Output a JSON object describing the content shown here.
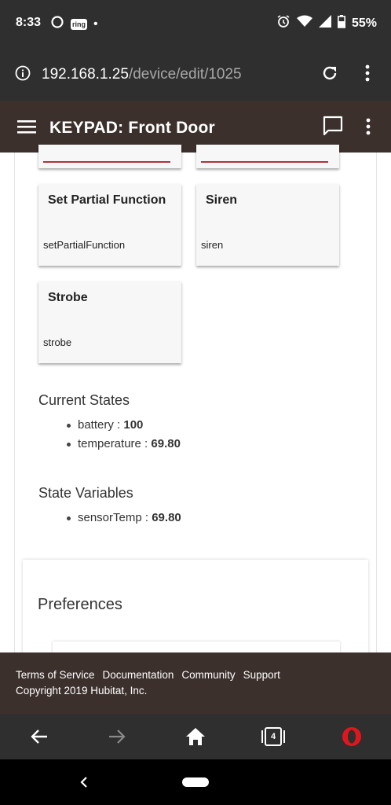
{
  "status_bar": {
    "time": "8:33",
    "ring_label": "ring",
    "dot": "•",
    "battery_percent": "55%",
    "icons": [
      "circle-notification-icon",
      "ring-app-icon",
      "alarm-icon",
      "wifi-icon",
      "signal-icon",
      "battery-icon"
    ]
  },
  "browser": {
    "url_host": "192.168.1.25",
    "url_path": "/device/edit/1025",
    "icons": [
      "info-icon",
      "reload-icon",
      "more-vert-icon"
    ]
  },
  "app_header": {
    "title": "KEYPAD: Front Door",
    "icons": [
      "hamburger-menu-icon",
      "chat-icon",
      "more-vert-icon"
    ]
  },
  "command_cards": [
    {
      "title": "Set Partial Function",
      "command": "setPartialFunction"
    },
    {
      "title": "Siren",
      "command": "siren"
    },
    {
      "title": "Strobe",
      "command": "strobe"
    }
  ],
  "current_states": {
    "heading": "Current States",
    "items": [
      {
        "name": "battery",
        "sep": " : ",
        "value": "100"
      },
      {
        "name": "temperature",
        "sep": " : ",
        "value": "69.80"
      }
    ]
  },
  "state_variables": {
    "heading": "State Variables",
    "items": [
      {
        "name": "sensorTemp",
        "sep": " : ",
        "value": "69.80"
      }
    ]
  },
  "preferences": {
    "heading": "Preferences"
  },
  "footer": {
    "links": [
      "Terms of Service",
      "Documentation",
      "Community",
      "Support"
    ],
    "copyright": "Copyright 2019 Hubitat, Inc."
  },
  "bottom_nav": {
    "tab_count": "4",
    "icons": [
      "back-arrow-icon",
      "forward-arrow-icon",
      "home-icon",
      "tabs-icon",
      "opera-icon"
    ]
  },
  "colors": {
    "status_bar": "#2f2f2f",
    "app_header": "#3c302c",
    "accent_red": "#b5303a",
    "opera_red": "#e0161f"
  }
}
